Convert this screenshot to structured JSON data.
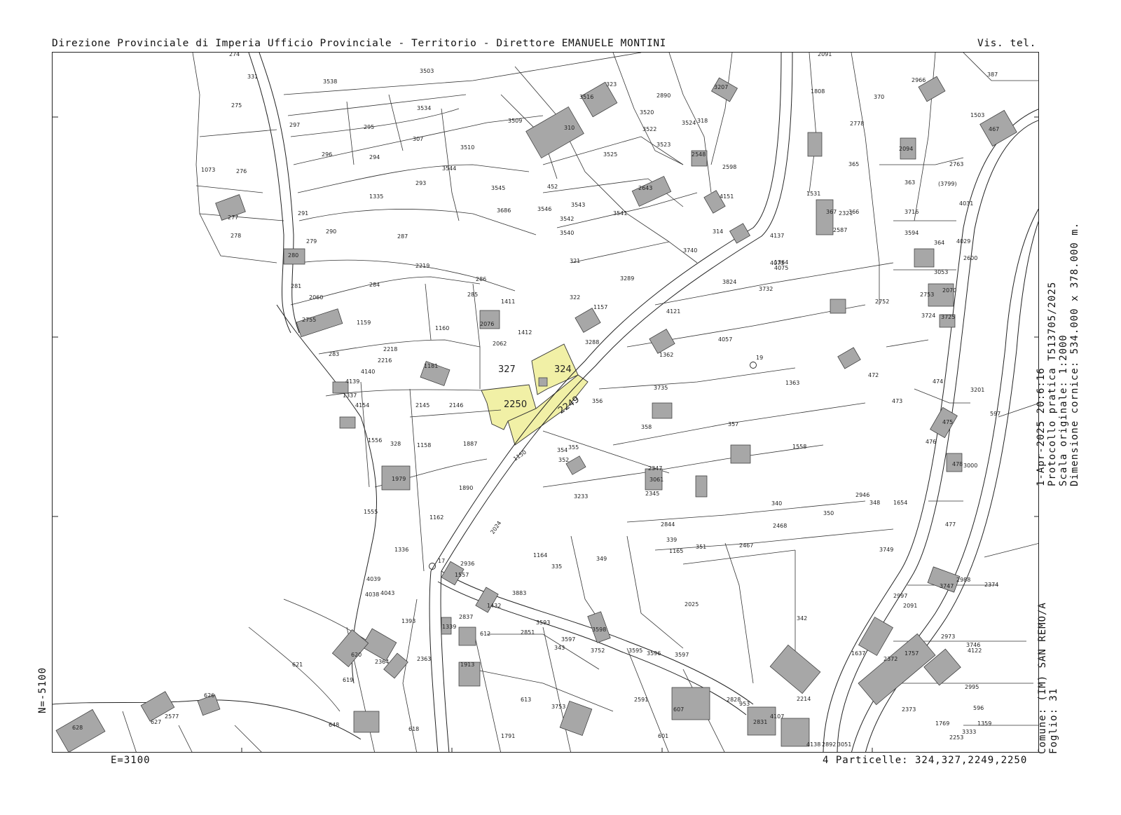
{
  "header": {
    "left": "Direzione Provinciale di Imperia  Ufficio Provinciale - Territorio - Direttore EMANUELE MONTINI",
    "right": "Vis. tel."
  },
  "side_top": {
    "line1": "1-Apr-2025 20:6:16",
    "line2": "Protocollo pratica T513705/2025",
    "line3": "Scala originale: 1:2000",
    "line4": "Dimensione cornice: 534.000 x 378.000 m."
  },
  "side_bottom": {
    "line1": "Comune: (IM) SAN REMO/A",
    "line2": "Foglio: 31"
  },
  "coords": {
    "north": "N=-5100",
    "east": "E=3100"
  },
  "footer": {
    "parcels": "4 Particelle: 324,327,2249,2250"
  },
  "map": {
    "highlight_color": "#f1f0a6",
    "building_color": "#a7a7a7",
    "highlighted_parcels": [
      {
        "id": "2250",
        "label": "2250"
      },
      {
        "id": "324",
        "label": "324"
      },
      {
        "id": "2249",
        "label": "2249"
      }
    ],
    "parcel_labels": [
      {
        "label": "274"
      },
      {
        "label": "331"
      },
      {
        "label": "275"
      },
      {
        "label": "276"
      },
      {
        "label": "1073"
      },
      {
        "label": "297"
      },
      {
        "label": "296"
      },
      {
        "label": "277"
      },
      {
        "label": "278"
      },
      {
        "label": "291"
      },
      {
        "label": "290"
      },
      {
        "label": "279"
      },
      {
        "label": "280"
      },
      {
        "label": "281"
      },
      {
        "label": "2060"
      },
      {
        "label": "2755"
      },
      {
        "label": "283"
      },
      {
        "label": "4140"
      },
      {
        "label": "4139"
      },
      {
        "label": "1337"
      },
      {
        "label": "4154"
      },
      {
        "label": "1556"
      },
      {
        "label": "328"
      },
      {
        "label": "1979"
      },
      {
        "label": "1555"
      },
      {
        "label": "1336"
      },
      {
        "label": "4039"
      },
      {
        "label": "4038"
      },
      {
        "label": "4043"
      },
      {
        "label": "1393"
      },
      {
        "label": "620"
      },
      {
        "label": "2364"
      },
      {
        "label": "2363"
      },
      {
        "label": "621"
      },
      {
        "label": "619"
      },
      {
        "label": "627"
      },
      {
        "label": "2577"
      },
      {
        "label": "626"
      },
      {
        "label": "628"
      },
      {
        "label": "648"
      },
      {
        "label": "618"
      },
      {
        "label": "3538"
      },
      {
        "label": "3503"
      },
      {
        "label": "3534"
      },
      {
        "label": "295"
      },
      {
        "label": "307"
      },
      {
        "label": "3510"
      },
      {
        "label": "294"
      },
      {
        "label": "3544"
      },
      {
        "label": "293"
      },
      {
        "label": "3545"
      },
      {
        "label": "3686"
      },
      {
        "label": "1335"
      },
      {
        "label": "287"
      },
      {
        "label": "2219"
      },
      {
        "label": "284"
      },
      {
        "label": "286"
      },
      {
        "label": "285"
      },
      {
        "label": "1159"
      },
      {
        "label": "1160"
      },
      {
        "label": "2076"
      },
      {
        "label": "2062"
      },
      {
        "label": "1411"
      },
      {
        "label": "1412"
      },
      {
        "label": "327"
      },
      {
        "label": "2216"
      },
      {
        "label": "2218"
      },
      {
        "label": "1181"
      },
      {
        "label": "2145"
      },
      {
        "label": "2146"
      },
      {
        "label": "1158"
      },
      {
        "label": "1887"
      },
      {
        "label": "1890"
      },
      {
        "label": "1162"
      },
      {
        "label": "2936"
      },
      {
        "label": "1557"
      },
      {
        "label": "3883"
      },
      {
        "label": "1432"
      },
      {
        "label": "2837"
      },
      {
        "label": "1339"
      },
      {
        "label": "612"
      },
      {
        "label": "1913"
      },
      {
        "label": "613"
      },
      {
        "label": "1791"
      },
      {
        "label": "3516"
      },
      {
        "label": "310"
      },
      {
        "label": "3509"
      },
      {
        "label": "3525"
      },
      {
        "label": "452"
      },
      {
        "label": "3546"
      },
      {
        "label": "3543"
      },
      {
        "label": "3541"
      },
      {
        "label": "3542"
      },
      {
        "label": "3540"
      },
      {
        "label": "321"
      },
      {
        "label": "322"
      },
      {
        "label": "1157"
      },
      {
        "label": "3289"
      },
      {
        "label": "3288"
      },
      {
        "label": "323"
      },
      {
        "label": "2890"
      },
      {
        "label": "3520"
      },
      {
        "label": "3522"
      },
      {
        "label": "3523"
      },
      {
        "label": "3524"
      },
      {
        "label": "318"
      },
      {
        "label": "3207"
      },
      {
        "label": "2643"
      },
      {
        "label": "2548"
      },
      {
        "label": "2598"
      },
      {
        "label": "4151"
      },
      {
        "label": "314"
      },
      {
        "label": "3740"
      },
      {
        "label": "3824"
      },
      {
        "label": "4121"
      },
      {
        "label": "4057"
      },
      {
        "label": "4073"
      },
      {
        "label": "3732"
      },
      {
        "label": "4137"
      },
      {
        "label": "3735"
      },
      {
        "label": "358"
      },
      {
        "label": "357"
      },
      {
        "label": "1558"
      },
      {
        "label": "352"
      },
      {
        "label": "354"
      },
      {
        "label": "355"
      },
      {
        "label": "356"
      },
      {
        "label": "3233"
      },
      {
        "label": "2347"
      },
      {
        "label": "2345"
      },
      {
        "label": "3061"
      },
      {
        "label": "2844"
      },
      {
        "label": "339"
      },
      {
        "label": "1165"
      },
      {
        "label": "340"
      },
      {
        "label": "351"
      },
      {
        "label": "2467"
      },
      {
        "label": "2468"
      },
      {
        "label": "350"
      },
      {
        "label": "349"
      },
      {
        "label": "1164"
      },
      {
        "label": "335"
      },
      {
        "label": "2025"
      },
      {
        "label": "343"
      },
      {
        "label": "3752"
      },
      {
        "label": "3595"
      },
      {
        "label": "3596"
      },
      {
        "label": "3597"
      },
      {
        "label": "3598"
      },
      {
        "label": "2591"
      },
      {
        "label": "607"
      },
      {
        "label": "953"
      },
      {
        "label": "4107"
      },
      {
        "label": "2214"
      },
      {
        "label": "342"
      },
      {
        "label": "601"
      },
      {
        "label": "2091"
      },
      {
        "label": "1808"
      },
      {
        "label": "370"
      },
      {
        "label": "2778"
      },
      {
        "label": "365"
      },
      {
        "label": "1531"
      },
      {
        "label": "366"
      },
      {
        "label": "367"
      },
      {
        "label": "2321"
      },
      {
        "label": "2587"
      },
      {
        "label": "363"
      },
      {
        "label": "(3799)"
      },
      {
        "label": "3716"
      },
      {
        "label": "3594"
      },
      {
        "label": "364"
      },
      {
        "label": "3053"
      },
      {
        "label": "2753"
      },
      {
        "label": "2752"
      },
      {
        "label": "2070"
      },
      {
        "label": "3725"
      },
      {
        "label": "3724"
      },
      {
        "label": "472"
      },
      {
        "label": "474"
      },
      {
        "label": "473"
      },
      {
        "label": "475"
      },
      {
        "label": "476"
      },
      {
        "label": "3201"
      },
      {
        "label": "2946"
      },
      {
        "label": "1654"
      },
      {
        "label": "348"
      },
      {
        "label": "3749"
      },
      {
        "label": "3747"
      },
      {
        "label": "2988"
      },
      {
        "label": "2997"
      },
      {
        "label": "2091"
      },
      {
        "label": "1757"
      },
      {
        "label": "2372"
      },
      {
        "label": "1637"
      },
      {
        "label": "2373"
      },
      {
        "label": "2374"
      },
      {
        "label": "3746"
      },
      {
        "label": "2995"
      },
      {
        "label": "596"
      },
      {
        "label": "597"
      },
      {
        "label": "3000"
      },
      {
        "label": "478"
      },
      {
        "label": "477"
      },
      {
        "label": "2966"
      },
      {
        "label": "387"
      },
      {
        "label": "1503"
      },
      {
        "label": "467"
      },
      {
        "label": "2094"
      },
      {
        "label": "2763"
      },
      {
        "label": "4031"
      },
      {
        "label": "4029"
      },
      {
        "label": "2600"
      },
      {
        "label": "3597"
      },
      {
        "label": "2851"
      },
      {
        "label": "3593"
      },
      {
        "label": "3753"
      },
      {
        "label": "2828"
      },
      {
        "label": "2831"
      },
      {
        "label": "1769"
      },
      {
        "label": "2253"
      },
      {
        "label": "3333"
      },
      {
        "label": "1359"
      },
      {
        "label": "1362"
      },
      {
        "label": "1363"
      },
      {
        "label": "1364"
      },
      {
        "label": "4075"
      },
      {
        "label": "2973"
      },
      {
        "label": "4122"
      },
      {
        "label": "4138"
      },
      {
        "label": "2892"
      },
      {
        "label": "3051"
      }
    ],
    "point_labels": [
      {
        "label": "17"
      },
      {
        "label": "19"
      }
    ],
    "road_labels": [
      {
        "label": "1150"
      },
      {
        "label": "2024"
      }
    ]
  }
}
